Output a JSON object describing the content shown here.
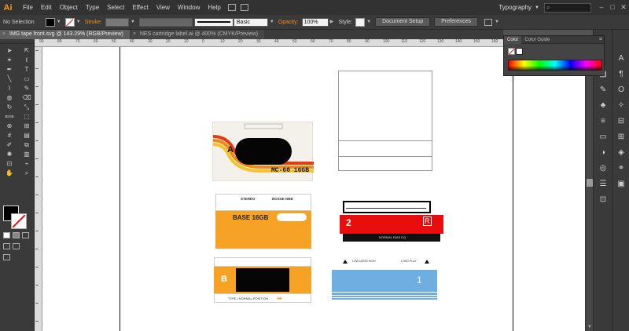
{
  "app": {
    "logo": "Ai",
    "workspace": "Typography"
  },
  "menu": [
    "File",
    "Edit",
    "Object",
    "Type",
    "Select",
    "Effect",
    "View",
    "Window",
    "Help"
  ],
  "control": {
    "selection": "No Selection",
    "stroke_label": "Stroke:",
    "brush": "Basic",
    "opacity_label": "Opacity:",
    "opacity": "100%",
    "style_label": "Style:",
    "doc_setup": "Document Setup",
    "preferences": "Preferences"
  },
  "tabs": [
    {
      "title": "IMG tape front.svg @ 143.29% (RGB/Preview)",
      "active": true
    },
    {
      "title": "NES cartridge label.ai @ 400% (CMYK/Preview)",
      "active": false
    }
  ],
  "ruler": {
    "top": [
      "90",
      "80",
      "70",
      "60",
      "50",
      "40",
      "30",
      "20",
      "10",
      "0",
      "10",
      "20",
      "30",
      "40",
      "50",
      "60",
      "70",
      "80",
      "90",
      "100",
      "110",
      "120",
      "130",
      "140",
      "150",
      "160"
    ]
  },
  "color_panel": {
    "tab_color": "Color",
    "tab_guide": "Color Guide"
  },
  "art": {
    "tape_a_letter": "A",
    "tape_a_text": "MC-60 16GB",
    "base_header_1": "STEREO",
    "base_header_2": "BOSSE NBB",
    "base_text": "BASE 16GB",
    "b_letter": "B",
    "b_small": "TYPE I NORMAL POSITION",
    "red_number": "2",
    "red_mark": "R",
    "red_strip": "NORMAL BIAS EQ",
    "blue_number": "1",
    "blue_top_1": "LOW NOISE HIGH",
    "blue_top_2": "LONG PLAY"
  },
  "colors": {
    "accent_orange": "#f6a225",
    "red": "#e80c0c",
    "blue": "#6eaee0",
    "ui_bg": "#535353"
  }
}
